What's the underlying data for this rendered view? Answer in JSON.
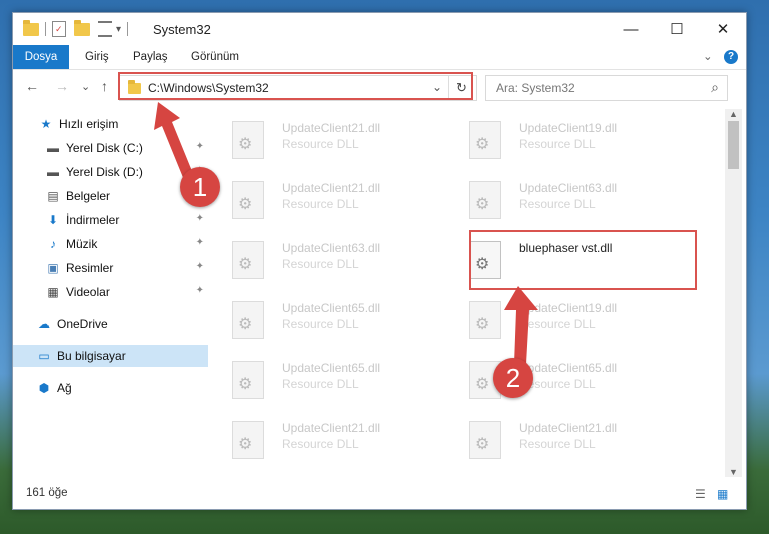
{
  "window": {
    "title": "System32",
    "controls": {
      "minimize": "—",
      "maximize": "☐",
      "close": "✕"
    }
  },
  "ribbon": {
    "tabs": [
      "Dosya",
      "Giriş",
      "Paylaş",
      "Görünüm"
    ],
    "expand": "⌄",
    "help": "?"
  },
  "nav": {
    "back": "←",
    "forward": "→",
    "recent": "⌄",
    "up": "↑",
    "address": "C:\\Windows\\System32",
    "address_dropdown": "⌄",
    "refresh": "↻",
    "search_placeholder": "Ara: System32",
    "search_icon": "⌕"
  },
  "sidebar": {
    "items": [
      {
        "label": "Hızlı erişim",
        "icon": "★"
      },
      {
        "label": "Yerel Disk (C:)",
        "icon": "▬",
        "pin": "📌"
      },
      {
        "label": "Yerel Disk (D:)",
        "icon": "▬",
        "pin": "📌"
      },
      {
        "label": "Belgeler",
        "icon": "▤",
        "pin": "📌"
      },
      {
        "label": "İndirmeler",
        "icon": "⬇",
        "pin": "📌"
      },
      {
        "label": "Müzik",
        "icon": "♪",
        "pin": "📌"
      },
      {
        "label": "Resimler",
        "icon": "▣",
        "pin": "📌"
      },
      {
        "label": "Videolar",
        "icon": "▦",
        "pin": "📌"
      },
      {
        "label": "OneDrive",
        "icon": "☁"
      },
      {
        "label": "Bu bilgisayar",
        "icon": "▭"
      },
      {
        "label": "Ağ",
        "icon": "⬢"
      }
    ]
  },
  "files": {
    "left": [
      {
        "name": "UpdateClient21.dll",
        "type": "Resource DLL"
      },
      {
        "name": "UpdateClient21.dll",
        "type": "Resource DLL"
      },
      {
        "name": "UpdateClient63.dll",
        "type": "Resource DLL"
      },
      {
        "name": "UpdateClient65.dll",
        "type": "Resource DLL"
      },
      {
        "name": "UpdateClient65.dll",
        "type": "Resource DLL"
      },
      {
        "name": "UpdateClient21.dll",
        "type": "Resource DLL"
      }
    ],
    "right": [
      {
        "name": "UpdateClient19.dll",
        "type": "Resource DLL"
      },
      {
        "name": "UpdateClient63.dll",
        "type": "Resource DLL"
      },
      {
        "name": "bluephaser vst.dll",
        "type": ""
      },
      {
        "name": "UpdateClient19.dll",
        "type": "Resource DLL"
      },
      {
        "name": "UpdateClient65.dll",
        "type": "Resource DLL"
      },
      {
        "name": "UpdateClient21.dll",
        "type": "Resource DLL"
      }
    ],
    "file_icon": "⚙"
  },
  "status": {
    "count": "161 öğe",
    "details_view": "☰",
    "tiles_view": "▦"
  },
  "annotations": {
    "step1": "1",
    "step2": "2",
    "color": "#d64541"
  }
}
